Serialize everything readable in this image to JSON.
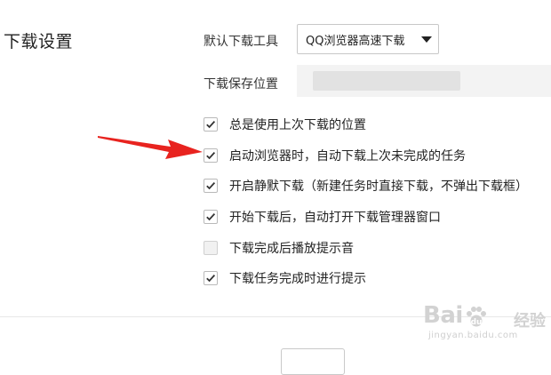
{
  "settings": {
    "section_title": "下载设置",
    "download_tool": {
      "label": "默认下载工具",
      "selected": "QQ浏览器高速下载"
    },
    "save_location": {
      "label": "下载保存位置",
      "value": ""
    },
    "options": [
      {
        "label": "总是使用上次下载的位置",
        "checked": true
      },
      {
        "label": "启动浏览器时，自动下载上次未完成的任务",
        "checked": true
      },
      {
        "label": "开启静默下载（新建任务时直接下载，不弹出下载框）",
        "checked": true
      },
      {
        "label": "开始下载后，自动打开下载管理器窗口",
        "checked": true
      },
      {
        "label": "下载完成后播放提示音",
        "checked": false
      },
      {
        "label": "下载任务完成时进行提示",
        "checked": true
      }
    ]
  },
  "watermark": {
    "brand": "Bai",
    "brand_suffix": "经验",
    "url": "jingyan.baidu.com"
  },
  "colors": {
    "annotation_arrow": "#e8231f",
    "check_mark": "#333333"
  },
  "icons": {
    "dropdown": "triangle-down",
    "checkbox_checked": "check-mark",
    "annotation": "red-arrow"
  }
}
